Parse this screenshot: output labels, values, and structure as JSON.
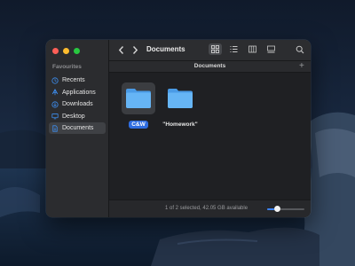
{
  "window": {
    "title": "Documents",
    "path_title": "Documents",
    "new_tab_symbol": "+"
  },
  "sidebar": {
    "heading": "Favourites",
    "items": [
      {
        "label": "Recents",
        "icon": "clock-icon",
        "selected": false
      },
      {
        "label": "Applications",
        "icon": "applications-icon",
        "selected": false
      },
      {
        "label": "Downloads",
        "icon": "download-icon",
        "selected": false
      },
      {
        "label": "Desktop",
        "icon": "desktop-icon",
        "selected": false
      },
      {
        "label": "Documents",
        "icon": "document-icon",
        "selected": true
      }
    ]
  },
  "toolbar": {
    "back_icon": "chevron-left-icon",
    "forward_icon": "chevron-right-icon",
    "views": [
      "icon-view",
      "list-view",
      "column-view",
      "gallery-view"
    ],
    "active_view": "icon-view",
    "search_icon": "search-icon"
  },
  "files": [
    {
      "name": "C&W",
      "type": "folder",
      "selected": true
    },
    {
      "name": "\"Homework\"",
      "type": "folder",
      "selected": false
    }
  ],
  "status": {
    "text": "1 of 2 selected, 42.05 GB available",
    "icon_size_level": 0.28
  },
  "colors": {
    "accent": "#2f6de0",
    "folder": "#5aaef0",
    "window_bg": "#232528"
  }
}
